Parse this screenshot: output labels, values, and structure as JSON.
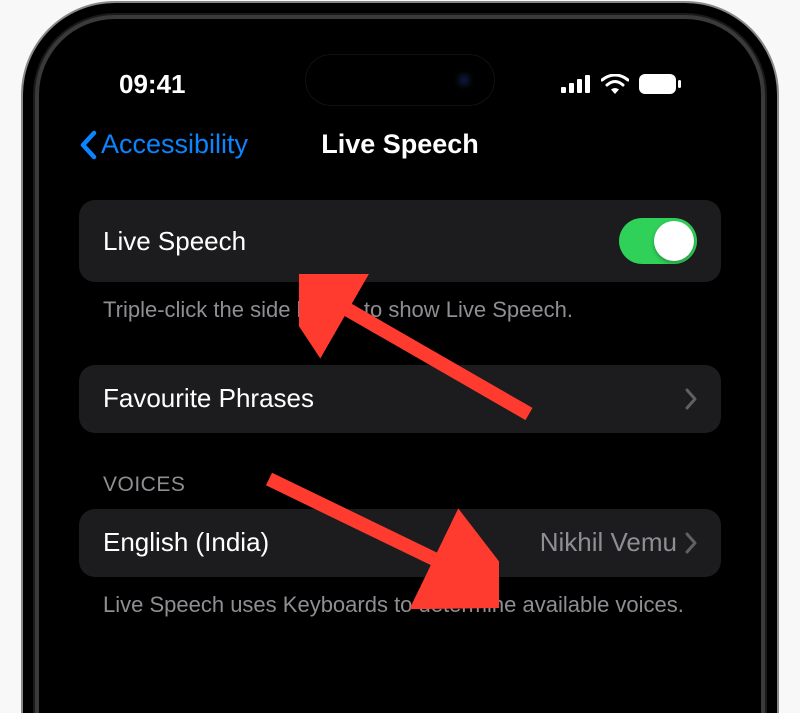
{
  "status": {
    "time": "09:41"
  },
  "nav": {
    "back_label": "Accessibility",
    "title": "Live Speech"
  },
  "sections": {
    "main": {
      "toggle_label": "Live Speech",
      "footer": "Triple-click the side button to show Live Speech."
    },
    "phrases": {
      "label": "Favourite Phrases"
    },
    "voices": {
      "header": "VOICES",
      "language": "English (India)",
      "selected_voice": "Nikhil Vemu",
      "footer": "Live Speech uses Keyboards to determine available voices."
    }
  }
}
